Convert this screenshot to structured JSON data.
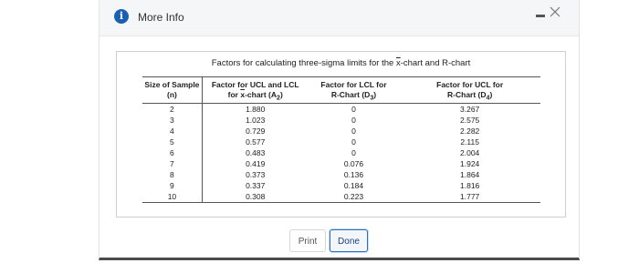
{
  "window": {
    "title": "More Info",
    "info_glyph": "i"
  },
  "table": {
    "caption_prefix": "Factors for calculating three-sigma limits for the ",
    "caption_xbar": "x",
    "caption_suffix": "-chart and R-chart",
    "headers": {
      "col1_line1": "Size of Sample",
      "col1_line2": "(n)",
      "col2_line1": "Factor for UCL and LCL",
      "col2_line2_prefix": "for ",
      "col2_line2_xbar": "x",
      "col2_line2_suffix": "-chart (A",
      "col2_sub": "2",
      "col2_close": ")",
      "col3_line1": "Factor for LCL for",
      "col3_line2": "R-Chart (D",
      "col3_sub": "3",
      "col3_close": ")",
      "col4_line1": "Factor for UCL for",
      "col4_line2": "R-Chart (D",
      "col4_sub": "4",
      "col4_close": ")"
    },
    "rows": [
      [
        "2",
        "1.880",
        "0",
        "3.267"
      ],
      [
        "3",
        "1.023",
        "0",
        "2.575"
      ],
      [
        "4",
        "0.729",
        "0",
        "2.282"
      ],
      [
        "5",
        "0.577",
        "0",
        "2.115"
      ],
      [
        "6",
        "0.483",
        "0",
        "2.004"
      ],
      [
        "7",
        "0.419",
        "0.076",
        "1.924"
      ],
      [
        "8",
        "0.373",
        "0.136",
        "1.864"
      ],
      [
        "9",
        "0.337",
        "0.184",
        "1.816"
      ],
      [
        "10",
        "0.308",
        "0.223",
        "1.777"
      ]
    ]
  },
  "buttons": {
    "print": "Print",
    "done": "Done"
  }
}
